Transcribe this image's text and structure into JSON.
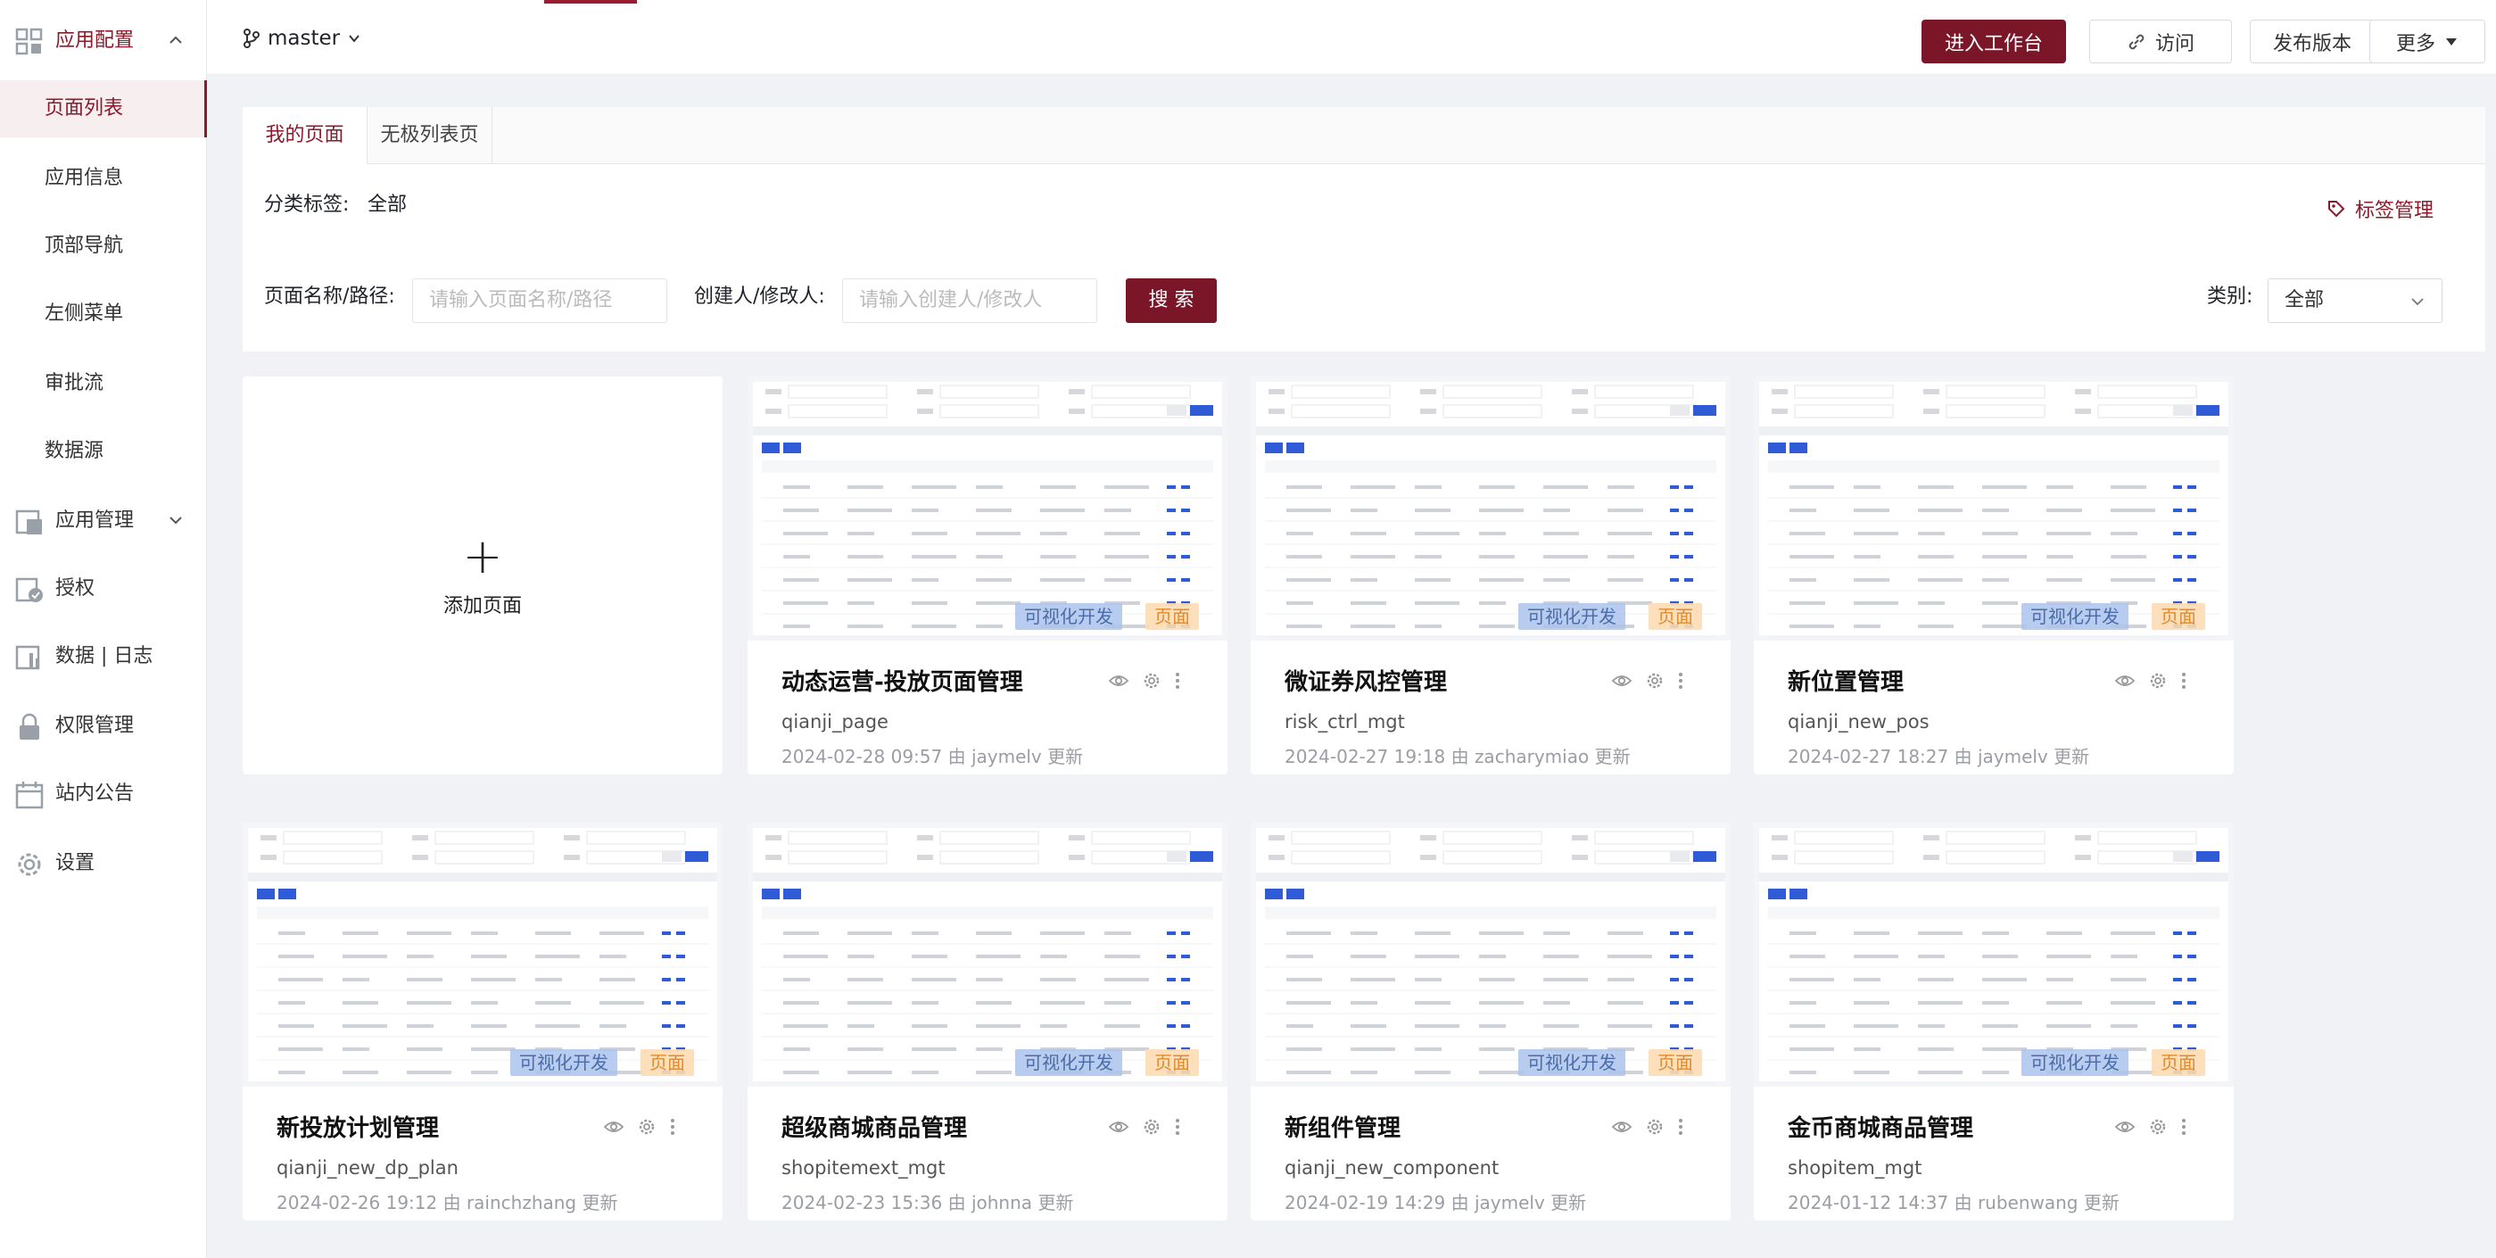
{
  "sidebar": {
    "group_app_config": "应用配置",
    "items": [
      "页面列表",
      "应用信息",
      "顶部导航",
      "左侧菜单",
      "审批流",
      "数据源"
    ],
    "group_app_manage": "应用管理",
    "auth": "授权",
    "data_log": "数据 | 日志",
    "permission": "权限管理",
    "announce": "站内公告",
    "settings": "设置"
  },
  "topbar": {
    "branch": "master",
    "workbench": "进入工作台",
    "visit": "访问",
    "publish": "发布版本",
    "more": "更多"
  },
  "tabs": [
    "我的页面",
    "无极列表页"
  ],
  "filters": {
    "category_label": "分类标签:",
    "category_value": "全部",
    "tag_manage": "标签管理",
    "name_label": "页面名称/路径:",
    "name_placeholder": "请输入页面名称/路径",
    "creator_label": "创建人/修改人:",
    "creator_placeholder": "请输入创建人/修改人",
    "search": "搜 索",
    "type_label": "类别:",
    "type_value": "全部"
  },
  "add_page": "添加页面",
  "badges": {
    "dev": "可视化开发",
    "page": "页面"
  },
  "cards": [
    {
      "title": "动态运营-投放页面管理",
      "key": "qianji_page",
      "meta": "2024-02-28 09:57 由 jaymelv 更新"
    },
    {
      "title": "微证券风控管理",
      "key": "risk_ctrl_mgt",
      "meta": "2024-02-27 19:18 由 zacharymiao 更新"
    },
    {
      "title": "新位置管理",
      "key": "qianji_new_pos",
      "meta": "2024-02-27 18:27 由 jaymelv 更新"
    },
    {
      "title": "新投放计划管理",
      "key": "qianji_new_dp_plan",
      "meta": "2024-02-26 19:12 由 rainchzhang 更新"
    },
    {
      "title": "超级商城商品管理",
      "key": "shopitemext_mgt",
      "meta": "2024-02-23 15:36 由 johnna 更新"
    },
    {
      "title": "新组件管理",
      "key": "qianji_new_component",
      "meta": "2024-02-19 14:29 由 jaymelv 更新"
    },
    {
      "title": "金币商城商品管理",
      "key": "shopitem_mgt",
      "meta": "2024-01-12 14:37 由 rubenwang 更新"
    }
  ],
  "colors": {
    "brand": "#7b1528",
    "active_bg": "#f6eeef"
  }
}
